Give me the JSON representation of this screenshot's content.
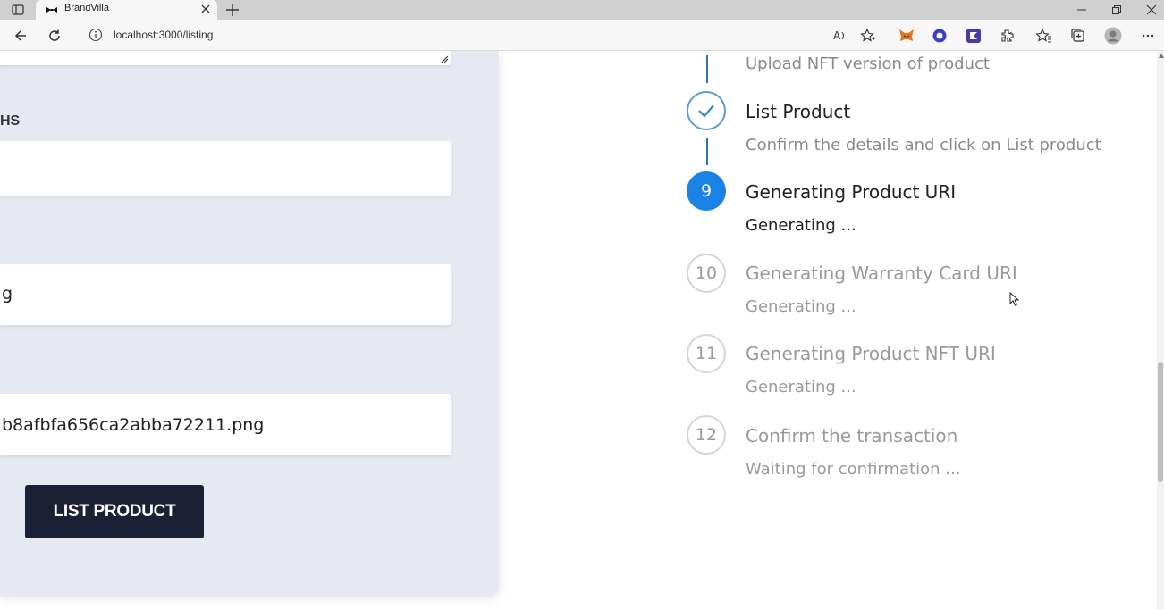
{
  "browser": {
    "tab_title": "BrandVilla",
    "address": "localhost:3000/listing"
  },
  "form": {
    "field_label_fragment": "HS",
    "input_2_fragment": "g",
    "image_filename": "b8afbfa656ca2abba72211.png",
    "submit_label": "LIST PRODUCT"
  },
  "stepper": {
    "steps": [
      {
        "number": "",
        "title": "",
        "description": "Upload NFT version of product",
        "state": "done"
      },
      {
        "number": "",
        "title": "List Product",
        "description": "Confirm the details and click on List product",
        "state": "done"
      },
      {
        "number": "9",
        "title": "Generating Product URI",
        "description": "Generating ...",
        "state": "active"
      },
      {
        "number": "10",
        "title": "Generating Warranty Card URI",
        "description": "Generating ...",
        "state": "pending"
      },
      {
        "number": "11",
        "title": "Generating Product NFT URI",
        "description": "Generating ...",
        "state": "pending"
      },
      {
        "number": "12",
        "title": "Confirm the transaction",
        "description": "Waiting for confirmation ...",
        "state": "pending"
      }
    ]
  },
  "colors": {
    "accent": "#1b82e6",
    "button_bg": "#1b2035",
    "panel_bg": "#e6e9f1"
  }
}
